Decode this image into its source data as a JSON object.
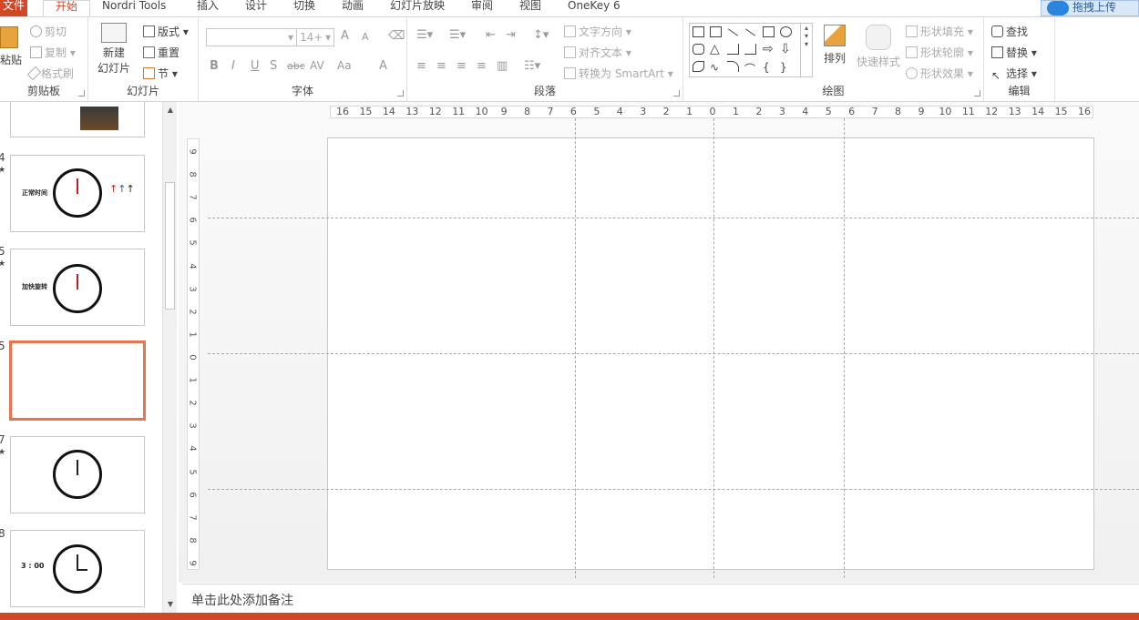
{
  "tabs": {
    "file": "文件",
    "home": "开始",
    "nordri": "Nordri Tools",
    "insert": "插入",
    "design": "设计",
    "transitions": "切换",
    "animations": "动画",
    "slideshow": "幻灯片放映",
    "review": "审阅",
    "view": "视图",
    "onekey": "OneKey 6"
  },
  "upload_label": "拖拽上传",
  "clipboard": {
    "paste": "粘贴",
    "cut": "剪切",
    "copy": "复制",
    "format_painter": "格式刷",
    "label": "剪贴板"
  },
  "slides_group": {
    "new_slide_line1": "新建",
    "new_slide_line2": "幻灯片",
    "layout": "版式",
    "reset": "重置",
    "section": "节",
    "label": "幻灯片"
  },
  "font_group": {
    "font_size": "14+",
    "label": "字体",
    "bold": "B",
    "italic": "I",
    "underline": "U",
    "shadow": "S",
    "strike": "abc",
    "spacing": "AV",
    "case": "Aa",
    "color": "A",
    "grow": "A",
    "shrink": "A"
  },
  "paragraph_group": {
    "text_direction": "文字方向",
    "align_text": "对齐文本",
    "smartart": "转换为 SmartArt",
    "label": "段落"
  },
  "drawing_group": {
    "arrange": "排列",
    "quick_styles": "快速样式",
    "shape_fill": "形状填充",
    "shape_outline": "形状轮廓",
    "shape_effects": "形状效果",
    "label": "绘图"
  },
  "editing_group": {
    "find": "查找",
    "replace": "替换",
    "select": "选择",
    "label": "编辑"
  },
  "thumbnails": [
    {
      "num": "4",
      "text": "正常时间"
    },
    {
      "num": "5",
      "text": "加快旋转"
    },
    {
      "num": "5",
      "text": ""
    },
    {
      "num": "7",
      "text": ""
    },
    {
      "num": "8",
      "text": "3 : 00"
    }
  ],
  "ruler_h": [
    "16",
    "15",
    "14",
    "13",
    "12",
    "11",
    "10",
    "9",
    "8",
    "7",
    "6",
    "5",
    "4",
    "3",
    "2",
    "1",
    "0",
    "1",
    "2",
    "3",
    "4",
    "5",
    "6",
    "7",
    "8",
    "9",
    "10",
    "11",
    "12",
    "13",
    "14",
    "15",
    "16"
  ],
  "ruler_v": [
    "9",
    "8",
    "7",
    "6",
    "5",
    "4",
    "3",
    "2",
    "1",
    "0",
    "1",
    "2",
    "3",
    "4",
    "5",
    "6",
    "7",
    "8",
    "9"
  ],
  "notes_placeholder": "单击此处添加备注",
  "colors": {
    "accent": "#d24726",
    "selected_thumb": "#e8734f"
  }
}
